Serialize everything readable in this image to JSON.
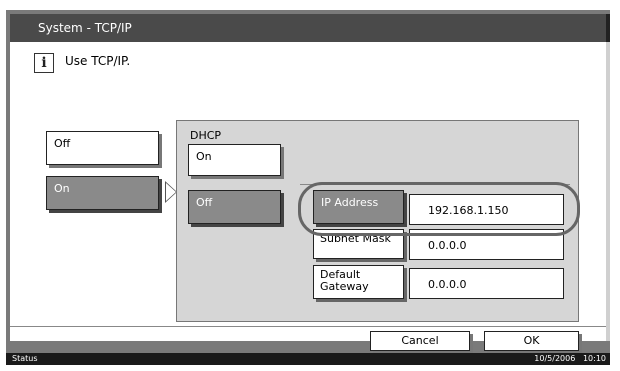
{
  "header": {
    "title": "System - TCP/IP"
  },
  "message": {
    "icon": "info-icon",
    "text": "Use TCP/IP."
  },
  "tcpip": {
    "off_label": "Off",
    "on_label": "On",
    "selected": "On"
  },
  "dhcp": {
    "label": "DHCP",
    "on_label": "On",
    "off_label": "Off",
    "selected": "Off"
  },
  "fields": {
    "ip_address": {
      "label": "IP Address",
      "value": "192.168.1.150"
    },
    "subnet_mask": {
      "label": "Subnet Mask",
      "value": "0.0.0.0"
    },
    "default_gateway": {
      "label": "Default\nGateway",
      "value": "0.0.0.0"
    }
  },
  "footer": {
    "cancel_label": "Cancel",
    "ok_label": "OK"
  },
  "status": {
    "label": "Status",
    "datetime": "10/5/2006   10:10"
  },
  "colors": {
    "panel": "#7a7a7a",
    "titlebar": "#4a4a4a",
    "selected_button": "#8a8a8a",
    "statusbar": "#1a1a1a"
  }
}
